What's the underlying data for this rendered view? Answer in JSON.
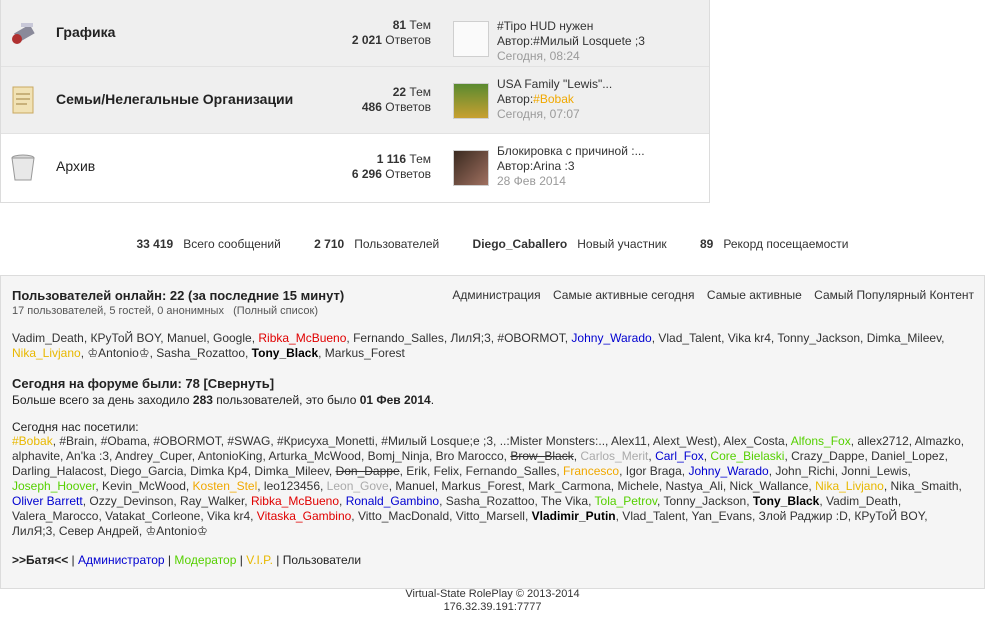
{
  "forums": [
    {
      "title": "Графика",
      "topics_num": "81",
      "topics_label": "Тем",
      "posts_num": "2 021",
      "posts_label": "Ответов",
      "last_title": "#Tipo НUD нужен",
      "last_author_label": "Автор:",
      "last_author": "#Милый Losquete ;3",
      "last_date": "Сегодня, 08:24"
    },
    {
      "title": "Семьи/Нелегальные Организации",
      "topics_num": "22",
      "topics_label": "Тем",
      "posts_num": "486",
      "posts_label": "Ответов",
      "last_title": "USA Family \"Lewis\"...",
      "last_author_label": "Автор:",
      "last_author": "#Bobak",
      "last_date": "Сегодня, 07:07"
    },
    {
      "title": "Архив",
      "topics_num": "1 116",
      "topics_label": "Тем",
      "posts_num": "6 296",
      "posts_label": "Ответов",
      "last_title": "Блокировка с причиной :...",
      "last_author_label": "Автор:",
      "last_author": "Arina :3",
      "last_date": "28 Фев 2014"
    }
  ],
  "stats": {
    "posts_num": "33 419",
    "posts_label": "Всего сообщений",
    "users_num": "2 710",
    "users_label": "Пользователей",
    "newest_name": "Diego_Caballero",
    "newest_label": "Новый участник",
    "record_num": "89",
    "record_label": "Рекорд посещаемости"
  },
  "online": {
    "title": "Пользователей онлайн: 22 (за последние 15 минут)",
    "subtitle": "17 пользователей, 5 гостей, 0 анонимных",
    "full_list": "(Полный список)",
    "links": [
      "Администрация",
      "Самые активные сегодня",
      "Самые активные",
      "Самый Популярный Контент"
    ],
    "users_line1": "Vadim_Death, КРуТоЙ BOY, Manuel, Google, ",
    "users_red1": "Ribka_McBueno",
    "users_line1b": ", Fernando_Salles, ЛилЯ;3, #OBORMOT, ",
    "users_blue1": "Johny_Warado",
    "users_line1c": ", Vlad_Talent, Vika kr4, Tonny_Jackson, Dimka_Mileev,",
    "users_gold2": "Nika_Livjano",
    "users_line2": ", ♔Antonio♔, Sasha_Rozattoo, ",
    "users_bold2": "Tony_Black",
    "users_line2b": ", Markus_Forest",
    "today_title": "Сегодня на форуме были: 78 [Свернуть]",
    "today_max_pre": "Больше всего за день заходило ",
    "today_max_num": "283",
    "today_max_mid": " пользователей, это было ",
    "today_max_date": "01 Фев 2014",
    "today_visited": "Сегодня нас посетили:",
    "legend": [
      ">>Батя<<",
      "Администратор",
      "Модератор",
      "V.I.P.",
      "Пользователи"
    ]
  },
  "footer": {
    "line1": "Virtual-State RolePlay © 2013-2014",
    "line2": "176.32.39.191:7777"
  }
}
